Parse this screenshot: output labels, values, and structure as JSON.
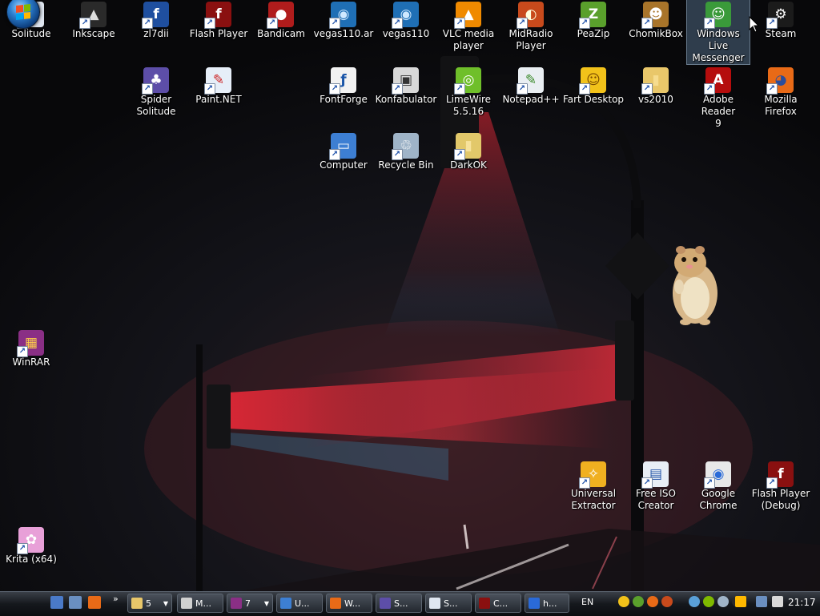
{
  "desktop": {
    "icons": [
      {
        "label": "Solitude",
        "name": "solitude-icon",
        "color": "#dfe6f0",
        "glyph": "♠",
        "gcolor": "#222"
      },
      {
        "label": "Inkscape",
        "name": "inkscape-icon",
        "color": "#2a2a2a",
        "glyph": "▲",
        "gcolor": "#ddd"
      },
      {
        "label": "zl7dii",
        "name": "zl7dii-icon",
        "color": "#1f4f9f",
        "glyph": "f",
        "gcolor": "#fff"
      },
      {
        "label": "Flash Player",
        "name": "flash-player-icon",
        "color": "#8a1010",
        "glyph": "f",
        "gcolor": "#fff"
      },
      {
        "label": "Bandicam",
        "name": "bandicam-icon",
        "color": "#b01c1c",
        "glyph": "●",
        "gcolor": "#fff"
      },
      {
        "label": "vegas110.ar",
        "name": "vegas-ar-icon",
        "color": "#1f6fb5",
        "glyph": "◉",
        "gcolor": "#cfe8ff"
      },
      {
        "label": "vegas110",
        "name": "vegas-icon",
        "color": "#1f6fb5",
        "glyph": "◉",
        "gcolor": "#cfe8ff"
      },
      {
        "label": "VLC media\nplayer",
        "name": "vlc-icon",
        "color": "#f08a00",
        "glyph": "▲",
        "gcolor": "#fff"
      },
      {
        "label": "MidRadio\nPlayer",
        "name": "midradio-icon",
        "color": "#c84a1c",
        "glyph": "◐",
        "gcolor": "#ffd"
      },
      {
        "label": "PeaZip",
        "name": "peazip-icon",
        "color": "#5aa02c",
        "glyph": "Z",
        "gcolor": "#fff"
      },
      {
        "label": "ChomikBox",
        "name": "chomikbox-icon",
        "color": "#a8742a",
        "glyph": "☻",
        "gcolor": "#fff"
      },
      {
        "label": "Windows Live\nMessenger",
        "name": "windows-live-messenger-icon",
        "color": "#3a9a3a",
        "glyph": "☺",
        "gcolor": "#fff",
        "selected": true
      },
      {
        "label": "Steam",
        "name": "steam-icon",
        "color": "#1b1b1b",
        "glyph": "⚙",
        "gcolor": "#fff"
      },
      {
        "label": "Spider\nSolitude",
        "name": "spider-solitude-icon",
        "color": "#5d4ea8",
        "glyph": "♣",
        "gcolor": "#fff"
      },
      {
        "label": "Paint.NET",
        "name": "paint-net-icon",
        "color": "#e6eef8",
        "glyph": "✎",
        "gcolor": "#c22"
      },
      {
        "label": "FontForge",
        "name": "fontforge-icon",
        "color": "#f2f2f2",
        "glyph": "ƒ",
        "gcolor": "#1a55a8"
      },
      {
        "label": "Konfabulator",
        "name": "konfabulator-icon",
        "color": "#d8d8d8",
        "glyph": "▣",
        "gcolor": "#333"
      },
      {
        "label": "LimeWire\n5.5.16",
        "name": "limewire-icon",
        "color": "#6fbf2a",
        "glyph": "◎",
        "gcolor": "#fff"
      },
      {
        "label": "Notepad++",
        "name": "notepad-plus-icon",
        "color": "#e9eef2",
        "glyph": "✎",
        "gcolor": "#3a8a2a"
      },
      {
        "label": "Fart Desktop",
        "name": "fart-desktop-icon",
        "color": "#f2c21a",
        "glyph": "☺",
        "gcolor": "#7a4a00"
      },
      {
        "label": "vs2010",
        "name": "vs2010-folder-icon",
        "color": "#e9c76a",
        "glyph": "▮",
        "gcolor": "#f6dc8f"
      },
      {
        "label": "Adobe Reader\n9",
        "name": "adobe-reader-icon",
        "color": "#b50d0d",
        "glyph": "A",
        "gcolor": "#fff"
      },
      {
        "label": "Mozilla\nFirefox",
        "name": "firefox-icon",
        "color": "#e86a17",
        "glyph": "◕",
        "gcolor": "#2b4d9c"
      },
      {
        "label": "Computer",
        "name": "computer-icon",
        "color": "#3d7fd3",
        "glyph": "▭",
        "gcolor": "#fff"
      },
      {
        "label": "Recycle Bin",
        "name": "recycle-bin-icon",
        "color": "#9fb4c8",
        "glyph": "♲",
        "gcolor": "#fff"
      },
      {
        "label": "DarkOK",
        "name": "darkok-folder-icon",
        "color": "#e2c86a",
        "glyph": "▮",
        "gcolor": "#f7e29b"
      },
      {
        "label": "WinRAR",
        "name": "winrar-icon",
        "color": "#8a2f85",
        "glyph": "▦",
        "gcolor": "#ffd24a"
      },
      {
        "label": "Universal\nExtractor",
        "name": "universal-extractor-icon",
        "color": "#f0b020",
        "glyph": "✧",
        "gcolor": "#fff"
      },
      {
        "label": "Free ISO\nCreator",
        "name": "free-iso-creator-icon",
        "color": "#e8eef5",
        "glyph": "▤",
        "gcolor": "#2455a8"
      },
      {
        "label": "Google\nChrome",
        "name": "chrome-icon",
        "color": "#e8e8e8",
        "glyph": "◉",
        "gcolor": "#2a6ad8"
      },
      {
        "label": "Flash Player\n(Debug)",
        "name": "flash-player-debug-icon",
        "color": "#8a1010",
        "glyph": "f",
        "gcolor": "#fff"
      },
      {
        "label": "Krita (x64)",
        "name": "krita-icon",
        "color": "#e8a0d8",
        "glyph": "✿",
        "gcolor": "#fff"
      }
    ]
  },
  "taskbar": {
    "quick_launch": [
      {
        "name": "show-desktop-icon",
        "color": "#4a7ac8"
      },
      {
        "name": "switch-windows-icon",
        "color": "#6a8fc0"
      },
      {
        "name": "firefox-quicklaunch-icon",
        "color": "#e86a17"
      }
    ],
    "overflow_label": "»",
    "buttons": [
      {
        "name": "taskbar-group-explorer",
        "label": "5",
        "color": "#e9c76a",
        "dropdown": "▼"
      },
      {
        "name": "taskbar-button-m",
        "label": "M...",
        "color": "#d0d0d0",
        "dropdown": ""
      },
      {
        "name": "taskbar-group-winrar",
        "label": "7",
        "color": "#8a2f85",
        "dropdown": "▼"
      },
      {
        "name": "taskbar-button-u",
        "label": "U...",
        "color": "#3d7fd3",
        "dropdown": ""
      },
      {
        "name": "taskbar-button-w",
        "label": "W...",
        "color": "#e86a17",
        "dropdown": ""
      },
      {
        "name": "taskbar-button-s1",
        "label": "S...",
        "color": "#5d4ea8",
        "dropdown": ""
      },
      {
        "name": "taskbar-button-s2",
        "label": "S...",
        "color": "#dfe6f0",
        "dropdown": ""
      },
      {
        "name": "taskbar-button-c",
        "label": "C...",
        "color": "#8a1010",
        "dropdown": ""
      },
      {
        "name": "taskbar-button-h",
        "label": "h...",
        "color": "#2a6ad8",
        "dropdown": ""
      }
    ],
    "language": "EN",
    "tray_icons": [
      {
        "name": "emoticon-tray-icon",
        "color": "#f2c21a"
      },
      {
        "name": "messenger-tray-icon",
        "color": "#5aa02c"
      },
      {
        "name": "app-tray-icon-1",
        "color": "#e86a17"
      },
      {
        "name": "app-tray-icon-2",
        "color": "#c84a1c"
      },
      {
        "name": "network-tray-icon",
        "color": "#5aa0d8"
      },
      {
        "name": "app-tray-icon-3",
        "color": "#7fba00"
      },
      {
        "name": "app-tray-icon-4",
        "color": "#9fb4c8"
      },
      {
        "name": "app-tray-icon-5",
        "color": "#2a2a2a"
      },
      {
        "name": "app-tray-icon-6",
        "color": "#ffb900"
      },
      {
        "name": "monitor-tray-icon",
        "color": "#6a8fc0"
      },
      {
        "name": "volume-tray-icon",
        "color": "#d8d8d8"
      }
    ],
    "clock": "21:17"
  }
}
